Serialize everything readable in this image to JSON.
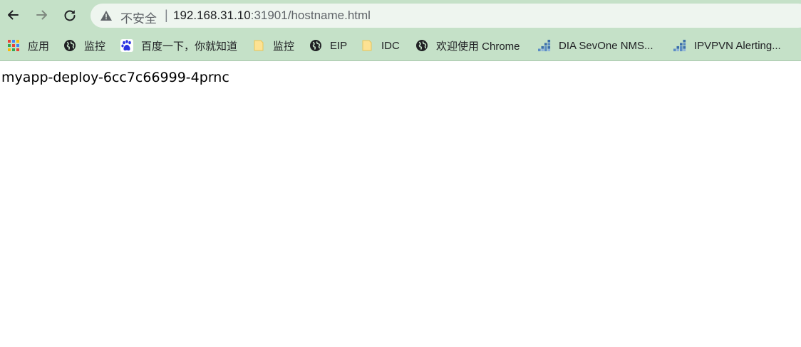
{
  "browser": {
    "address_bar": {
      "security_label": "不安全",
      "separator": "|",
      "url_host": "192.168.31.10",
      "url_rest": ":31901/hostname.html"
    },
    "bookmarks": [
      {
        "label": "应用",
        "icon": "apps-grid-icon"
      },
      {
        "label": "监控",
        "icon": "globe-icon"
      },
      {
        "label": "百度一下，你就知道",
        "icon": "baidu-paw-icon"
      },
      {
        "label": "监控",
        "icon": "folder-icon"
      },
      {
        "label": "EIP",
        "icon": "globe-icon"
      },
      {
        "label": "IDC",
        "icon": "folder-icon"
      },
      {
        "label": "欢迎使用 Chrome",
        "icon": "globe-icon"
      },
      {
        "label": "DIA SevOne NMS...",
        "icon": "sevone-icon"
      },
      {
        "label": "IPVPVN Alerting...",
        "icon": "sevone-icon"
      }
    ]
  },
  "page": {
    "hostname": "myapp-deploy-6cc7c66999-4prnc"
  }
}
